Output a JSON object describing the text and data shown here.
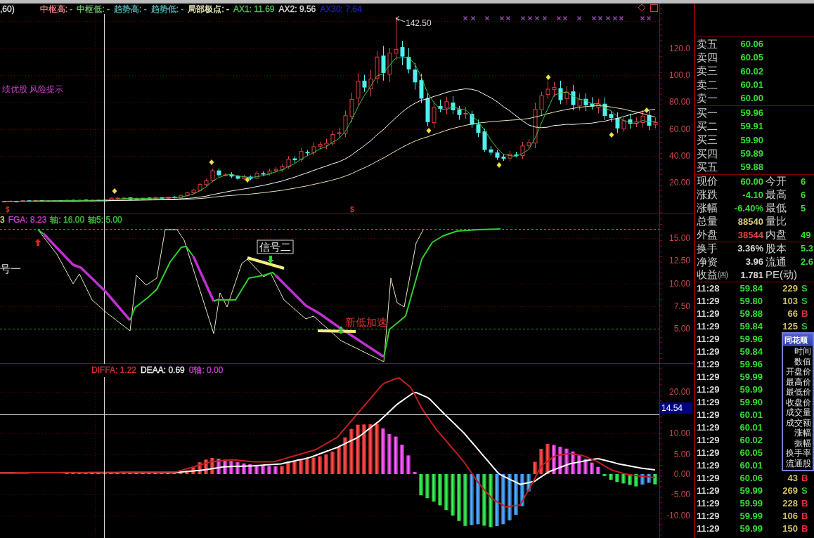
{
  "price_panel": {
    "legend": [
      {
        "text": ",60)",
        "color": "#e0e0e0"
      },
      {
        "text": "中枢高: -",
        "color": "#e08080"
      },
      {
        "text": "中枢低: -",
        "color": "#70c070"
      },
      {
        "text": "趋势高: -",
        "color": "#50b0b0"
      },
      {
        "text": "趋势低: -",
        "color": "#50b0b0"
      },
      {
        "text": "局部极点: -",
        "color": "#f0f0c0"
      },
      {
        "text": "AX1: 11.69",
        "color": "#50c050"
      },
      {
        "text": "AX2: 9.56",
        "color": "#d8d8d8"
      },
      {
        "text": "AX30: 7.64",
        "color": "#2020a8"
      }
    ],
    "note": "绩优股 风险提示",
    "peak_label": "142.50",
    "signal_marks": [
      "$",
      "$"
    ],
    "y_ticks": [
      "120.0",
      "100.0",
      "80.00",
      "60.00",
      "40.00",
      "20.00"
    ]
  },
  "indicator_panel": {
    "legend": [
      {
        "text": "3",
        "color": "#d8d890"
      },
      {
        "text": "FGA: 8.23",
        "color": "#c040c0"
      },
      {
        "text": "轴: 16.00",
        "color": "#40c040"
      },
      {
        "text": "轴5: 5.00",
        "color": "#40c040"
      }
    ],
    "annotations": [
      {
        "kind": "plain",
        "text": "号一"
      },
      {
        "kind": "boxed",
        "text": "信号二"
      },
      {
        "kind": "alert",
        "text": "新低加速"
      }
    ],
    "y_ticks": [
      "15.00",
      "12.50",
      "10.00",
      "7.50",
      "5.00"
    ]
  },
  "macd_panel": {
    "legend": [
      {
        "text": "DIFFA: 1.22",
        "color": "#d03030"
      },
      {
        "text": "DEAA: 0.69",
        "color": "#f0f0f0"
      },
      {
        "text": "0轴: 0.00",
        "color": "#c040c0"
      }
    ],
    "cursor_value": "14.54",
    "y_ticks": [
      "20.00",
      "10.00",
      "5.00",
      "0.00",
      "-5.00",
      "-10.00"
    ]
  },
  "order_book": {
    "asks": [
      {
        "label": "卖五",
        "price": "60.06"
      },
      {
        "label": "卖四",
        "price": "60.05"
      },
      {
        "label": "卖三",
        "price": "60.02"
      },
      {
        "label": "卖二",
        "price": "60.01"
      },
      {
        "label": "卖一",
        "price": "60.00"
      }
    ],
    "bids": [
      {
        "label": "买一",
        "price": "59.96"
      },
      {
        "label": "买二",
        "price": "59.91"
      },
      {
        "label": "买三",
        "price": "59.90"
      },
      {
        "label": "买四",
        "price": "59.89"
      },
      {
        "label": "买五",
        "price": "59.88"
      }
    ]
  },
  "quote": [
    {
      "label": "现价",
      "value": "60.00",
      "color": "#33dd33",
      "label2": "今开",
      "value2": "6"
    },
    {
      "label": "涨跌",
      "value": "-4.10",
      "color": "#33dd33",
      "label2": "最高",
      "value2": "6"
    },
    {
      "label": "涨幅",
      "value": "-6.40%",
      "color": "#33dd33",
      "label2": "最低",
      "value2": "5"
    },
    {
      "label": "总量",
      "value": "88540",
      "color": "#d8d070",
      "label2": "量比"
    },
    {
      "label": "外盘",
      "value": "38544",
      "color": "#e04848",
      "label2": "内盘",
      "value2": "49"
    }
  ],
  "fundamentals": [
    {
      "label": "换手",
      "value": "3.36%",
      "label2": "股本",
      "value2": "5.3"
    },
    {
      "label": "净资",
      "value": "3.96",
      "label2": "流通",
      "value2": "2.6"
    },
    {
      "label": "收益㈣",
      "value": "1.781",
      "label2": "PE(动)"
    }
  ],
  "ticks": [
    {
      "time": "11:28",
      "price": "59.84",
      "volume": "229",
      "side": "S",
      "color": "#30c030"
    },
    {
      "time": "11:29",
      "price": "59.80",
      "volume": "103",
      "side": "S",
      "color": "#30c030"
    },
    {
      "time": "11:29",
      "price": "59.88",
      "volume": "66",
      "side": "B",
      "color": "#e03030"
    },
    {
      "time": "11:29",
      "price": "59.84",
      "volume": "125",
      "side": "S",
      "color": "#30c030"
    },
    {
      "time": "11:29",
      "price": "59.96"
    },
    {
      "time": "11:29",
      "price": "59.84"
    },
    {
      "time": "11:29",
      "price": "59.96"
    },
    {
      "time": "11:29",
      "price": "59.99"
    },
    {
      "time": "11:29",
      "price": "59.99"
    },
    {
      "time": "11:29",
      "price": "59.90"
    },
    {
      "time": "11:29",
      "price": "60.01"
    },
    {
      "time": "11:29",
      "price": "60.01"
    },
    {
      "time": "11:29",
      "price": "60.02"
    },
    {
      "time": "11:29",
      "price": "60.05"
    },
    {
      "time": "11:29",
      "price": "60.01"
    },
    {
      "time": "11:29",
      "price": "60.06",
      "volume": "43",
      "side": "B",
      "color": "#e03030"
    },
    {
      "time": "11:29",
      "price": "59.99",
      "volume": "269",
      "side": "S",
      "color": "#30c030"
    },
    {
      "time": "11:29",
      "price": "59.99",
      "volume": "228",
      "side": "B",
      "color": "#e03030"
    },
    {
      "time": "11:29",
      "price": "59.99",
      "volume": "106",
      "side": "B",
      "color": "#e03030"
    },
    {
      "time": "11:29",
      "price": "59.99",
      "volume": "150",
      "side": "B",
      "color": "#e03030"
    }
  ],
  "context_menu": {
    "title": "同花顺",
    "items": [
      "时间",
      "数值",
      "开盘价",
      "最高价",
      "最低价",
      "收盘价",
      "成交量",
      "成交额",
      "涨幅",
      "振幅",
      "换手率",
      "流通股"
    ]
  }
}
